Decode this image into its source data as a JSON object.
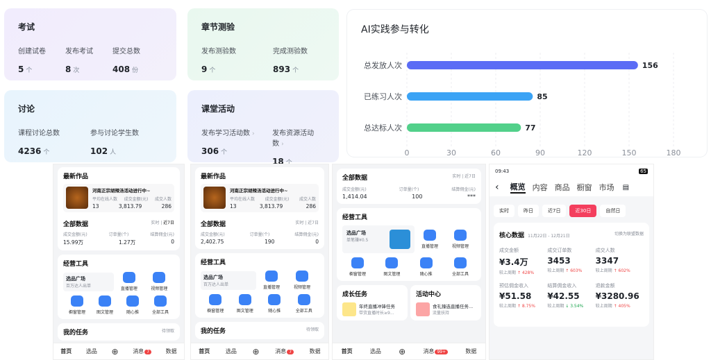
{
  "exam": {
    "title": "考试",
    "cols": [
      {
        "label": "创建试卷",
        "value": "5",
        "unit": "个"
      },
      {
        "label": "发布考试",
        "value": "8",
        "unit": "次"
      },
      {
        "label": "提交总数",
        "value": "408",
        "unit": "份"
      }
    ]
  },
  "quiz": {
    "title": "章节测验",
    "cols": [
      {
        "label": "发布测验数",
        "value": "9",
        "unit": "个"
      },
      {
        "label": "完成测验数",
        "value": "893",
        "unit": "个"
      }
    ]
  },
  "discuss": {
    "title": "讨论",
    "cols": [
      {
        "label": "课程讨论总数",
        "value": "4236",
        "unit": "个"
      },
      {
        "label": "参与讨论学生数",
        "value": "102",
        "unit": "人"
      }
    ]
  },
  "classact": {
    "title": "课堂活动",
    "cols": [
      {
        "label": "发布学习活动数",
        "value": "306",
        "unit": "个"
      },
      {
        "label": "发布资源活动数",
        "value": "18",
        "unit": "个"
      }
    ]
  },
  "chart_data": {
    "type": "bar",
    "orientation": "horizontal",
    "title": "AI实践参与转化",
    "categories": [
      "总发放人次",
      "已练习人次",
      "总达标人次"
    ],
    "values": [
      156,
      85,
      77
    ],
    "colors": [
      "#5b6cf5",
      "#3ba3f5",
      "#52d08a"
    ],
    "xlim": [
      0,
      180
    ],
    "xticks": [
      "0",
      "30",
      "60",
      "90",
      "120",
      "150",
      "180"
    ]
  },
  "p1": {
    "latest": "最新作品",
    "product": "河南正宗胡辣汤活动进行中~",
    "m_labels": [
      "平均在线人数",
      "成交金额(元)",
      "成交人数"
    ],
    "m_values": [
      "13",
      "3,813.79",
      "286"
    ],
    "all": "全部数据",
    "realtime": "实时",
    "days": "近7日",
    "a_labels": [
      "成交金额(元)",
      "订单量(个)",
      "结算佣金(元)"
    ],
    "a_values": [
      "15.99万",
      "1.27万",
      "0"
    ],
    "tools": "经营工具",
    "plaza": "选品广场",
    "plaza_sub": "百万达人出单",
    "t": [
      "直播管理",
      "视频管理",
      "橱窗管理",
      "图文管理",
      "随心推",
      "全部工具"
    ],
    "task": "我的任务",
    "task_more": "待领取",
    "tabs": [
      "首页",
      "选品",
      "",
      "消息",
      "数据"
    ],
    "badge": "7"
  },
  "p2": {
    "latest": "最新作品",
    "product": "河南正宗胡辣汤活动进行中~",
    "m_labels": [
      "平均在线人数",
      "成交金额(元)",
      "成交人数"
    ],
    "m_values": [
      "13",
      "3,813.79",
      "286"
    ],
    "all": "全部数据",
    "realtime": "实时",
    "days": "近7日",
    "a_labels": [
      "成交金额(元)",
      "订单量(个)",
      "结算佣金(元)"
    ],
    "a_values": [
      "2,402.75",
      "190",
      "0"
    ],
    "tools": "经营工具",
    "plaza": "选品广场",
    "plaza_sub": "百万达人出单",
    "t": [
      "直播管理",
      "视频管理",
      "橱窗管理",
      "图文管理",
      "随心推",
      "全部工具"
    ],
    "task": "我的任务",
    "task_more": "待领取",
    "tabs": [
      "首页",
      "选品",
      "",
      "消息",
      "数据"
    ],
    "badge": "7"
  },
  "p3": {
    "all": "全部数据",
    "realtime": "实时",
    "days": "近7日",
    "a_labels": [
      "成交金额(元)",
      "订单量(个)",
      "结算佣金(元)"
    ],
    "a_values": [
      "1,414.04",
      "100",
      "***"
    ],
    "tools": "经营工具",
    "plaza": "选品广场",
    "plaza_sub": "单笔赚¥0.5",
    "t": [
      "直播管理",
      "视频管理",
      "橱窗管理",
      "图文管理",
      "随心推",
      "全部工具"
    ],
    "growth": "成长任务",
    "growth_item": "年终直播冲锋任务",
    "growth_sub": "带货直播时长≥9...",
    "activity": "活动中心",
    "act_item": "食礼臻选直播任务...",
    "act_sub": "流量扶持",
    "tabs": [
      "首页",
      "选品",
      "",
      "消息",
      "数据"
    ],
    "badge": "99+"
  },
  "p4": {
    "time": "09:43",
    "battery": "65",
    "tabs": [
      "概览",
      "内容",
      "商品",
      "橱窗",
      "市场"
    ],
    "ranges": [
      "实时",
      "昨日",
      "近7日",
      "近30日",
      "自然日"
    ],
    "core": "核心数据",
    "daterange": "11月22日 - 12月21日",
    "switch": "切换为联盟数据",
    "metrics": [
      {
        "label": "成交金额",
        "value": "¥3.4万",
        "cmp": "较上周期",
        "chg": "↑ 428%",
        "color": "#ef4444"
      },
      {
        "label": "成交订单数",
        "value": "3453",
        "cmp": "较上周期",
        "chg": "↑ 603%",
        "color": "#ef4444"
      },
      {
        "label": "成交人数",
        "value": "3347",
        "cmp": "较上周期",
        "chg": "↑ 602%",
        "color": "#ef4444"
      },
      {
        "label": "预估佣金收入",
        "value": "¥51.58",
        "cmp": "较上周期",
        "chg": "↑ 8.75%",
        "color": "#ef4444"
      },
      {
        "label": "结算佣金收入",
        "value": "¥42.55",
        "cmp": "较上周期",
        "chg": "↓ 3.54%",
        "color": "#16a34a"
      },
      {
        "label": "退款金额",
        "value": "¥3280.96",
        "cmp": "较上周期",
        "chg": "↑ 405%",
        "color": "#ef4444"
      }
    ]
  }
}
